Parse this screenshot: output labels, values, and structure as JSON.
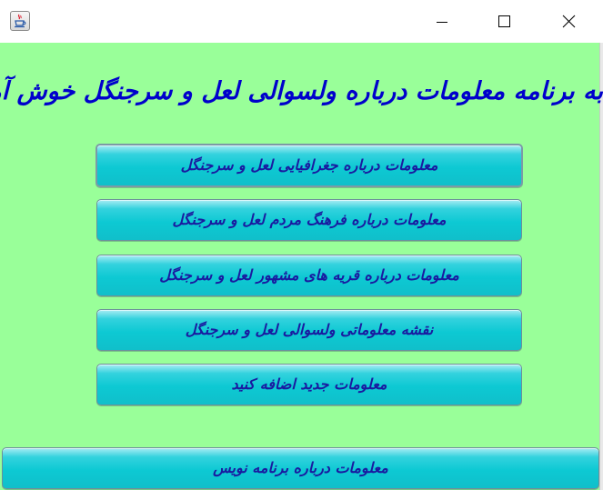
{
  "window": {
    "title": "",
    "icon": "java-cup-icon",
    "controls": {
      "minimize": "minimize-icon",
      "maximize": "maximize-icon",
      "close": "close-icon"
    }
  },
  "main": {
    "heading": "به برنامه معلومات درباره ولسوالی لعل و سرجنگل خوش آمدید",
    "buttons": [
      {
        "label": "معلومات درباره جغرافیایی لعل و سرجنگل"
      },
      {
        "label": "معلومات درباره فرهنگ مردم لعل و سرجنگل"
      },
      {
        "label": "معلومات درباره قریه های مشهور لعل و سرجنگل"
      },
      {
        "label": "نقشه معلوماتی ولسوالی لعل و سرجنگل"
      },
      {
        "label": "معلومات جدید اضافه کنید"
      }
    ],
    "about_button": "معلومات درباره برنامه نویس"
  },
  "colors": {
    "background": "#99ff99",
    "button": "#0dc9d3",
    "text": "#1a1aa0",
    "heading": "#0000cc"
  }
}
